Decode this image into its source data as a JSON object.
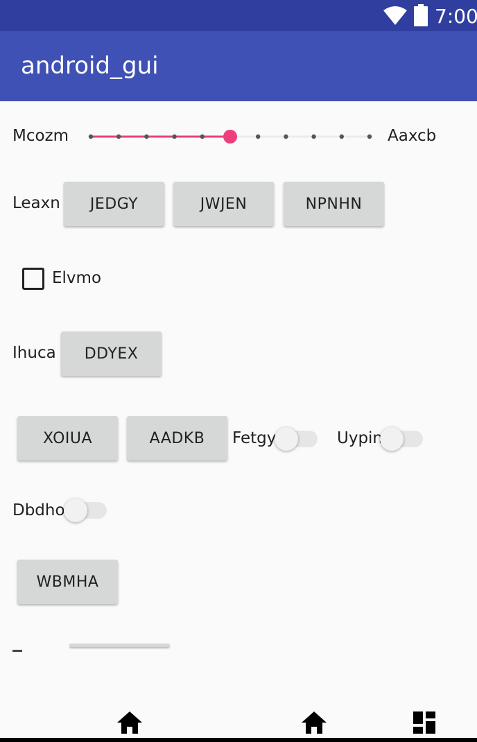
{
  "status_bar": {
    "time": "7:00",
    "wifi_icon": "wifi-icon",
    "battery_icon": "battery-icon"
  },
  "app_bar": {
    "title": "android_gui"
  },
  "seekbar_row": {
    "left_label": "Mcozm",
    "right_label": "Aaxcb",
    "progress": 5,
    "max": 10,
    "accent": "#ee3f7d"
  },
  "button_row_1": {
    "label": "Leaxn",
    "buttons": [
      "JEDGY",
      "JWJEN",
      "NPNHN"
    ]
  },
  "checkbox": {
    "label": "Elvmo",
    "checked": false
  },
  "button_row_2": {
    "label": "Ihuca",
    "button": "DDYEX"
  },
  "button_row_3": {
    "buttons": [
      "XOIUA",
      "AADKB"
    ],
    "switch_1_label": "Fetgy",
    "switch_2_label": "Uypin"
  },
  "switch_row": {
    "label": "Dbdho"
  },
  "button_row_4": {
    "button": "WBMHA"
  },
  "nav_bar": {
    "icons": [
      "home-icon",
      "home-icon",
      "apps-icon"
    ]
  },
  "colors": {
    "primary": "#3f51b5",
    "primary_dark": "#303f9f",
    "accent": "#ee3f7d"
  }
}
